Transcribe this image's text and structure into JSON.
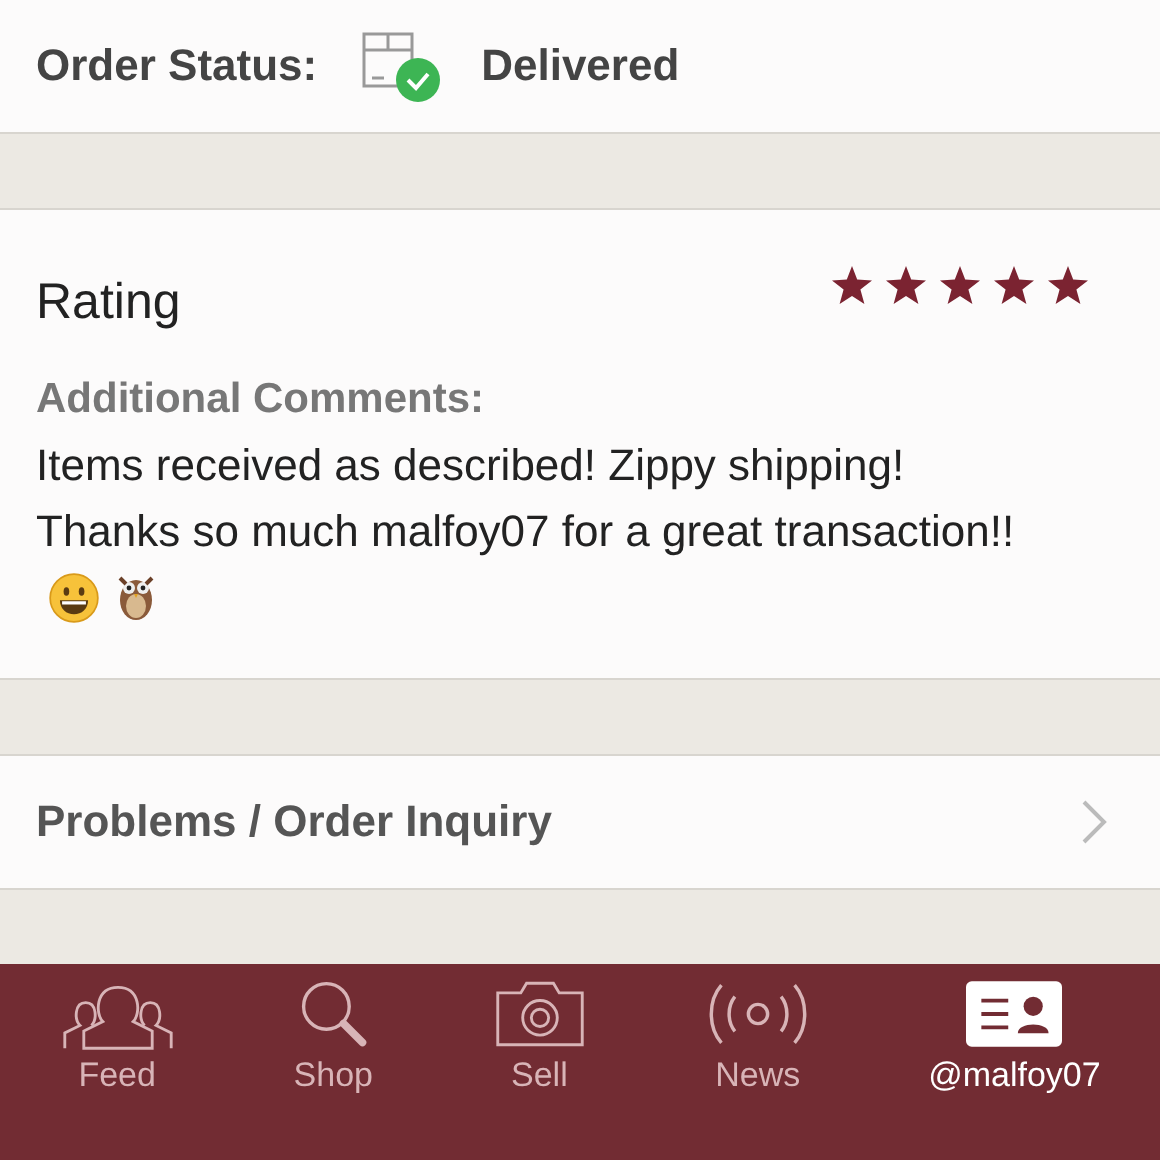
{
  "order_status": {
    "label": "Order Status:",
    "value": "Delivered"
  },
  "rating": {
    "title": "Rating",
    "stars": 5,
    "comments_label": "Additional Comments:",
    "comments": "Items received as described! Zippy shipping! Thanks so much malfoy07 for a great transaction!!"
  },
  "problems_link": {
    "label": "Problems / Order Inquiry"
  },
  "tab_bar": [
    {
      "label": "Feed",
      "kind": "people",
      "selected": false
    },
    {
      "label": "Shop",
      "kind": "search",
      "selected": false
    },
    {
      "label": "Sell",
      "kind": "camera",
      "selected": false
    },
    {
      "label": "News",
      "kind": "broadcast",
      "selected": false
    },
    {
      "label": "@malfoy07",
      "kind": "profile",
      "selected": true
    }
  ]
}
